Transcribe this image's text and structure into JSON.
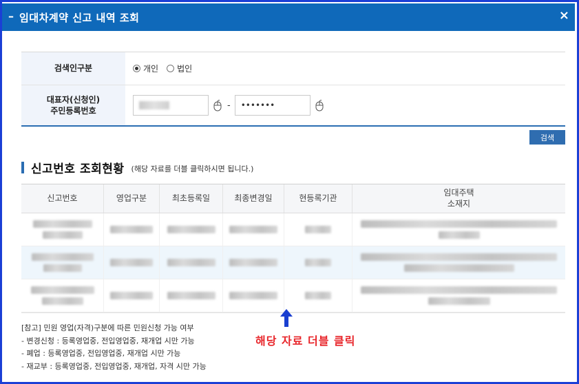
{
  "window": {
    "title": "임대차계약 신고 내역 조회",
    "collapse_glyph": "–",
    "close_glyph": "×",
    "title_bar_color": "#0f69ba",
    "border_color": "#1b3fd6"
  },
  "search_form": {
    "type_label": "검색인구분",
    "options": [
      {
        "label": "개인",
        "selected": true
      },
      {
        "label": "법인",
        "selected": false
      }
    ],
    "id_label_line1": "대표자(신청인)",
    "id_label_line2": "주민등록번호",
    "id_front_value": "",
    "id_separator": "-",
    "id_back_value": "•••••••",
    "mouse_icon": "mouse-icon",
    "search_button": "검색",
    "button_color": "#2f6db0"
  },
  "results": {
    "section_title": "신고번호 조회현황",
    "hint": "(해당 자료를 더블 클릭하시면 됩니다.)",
    "columns": [
      {
        "label": "신고번호"
      },
      {
        "label": "영업구분"
      },
      {
        "label": "최초등록일"
      },
      {
        "label": "최종변경일"
      },
      {
        "label": "현등록기관"
      },
      {
        "label_line1": "임대주택",
        "label_line2": "소재지"
      }
    ],
    "rows_note": "row contents are blurred/redacted in the screenshot",
    "row_count": 3,
    "highlight_color": "#eef6fc"
  },
  "annotation": {
    "arrow_icon": "arrow-up-icon",
    "text": "해당 자료 더블 클릭",
    "color": "#e8262b"
  },
  "notes": [
    "[참고] 민원 영업(자격)구분에 따른 민원신청 가능 여부",
    "- 변경신청 : 등록영업중, 전입영업중, 재개업 시만 가능",
    "- 폐업 : 등록영업중, 전입영업중, 재개업 시만 가능",
    "- 재교부 : 등록영업중, 전입영업중, 재개업, 자격 시만 가능"
  ]
}
